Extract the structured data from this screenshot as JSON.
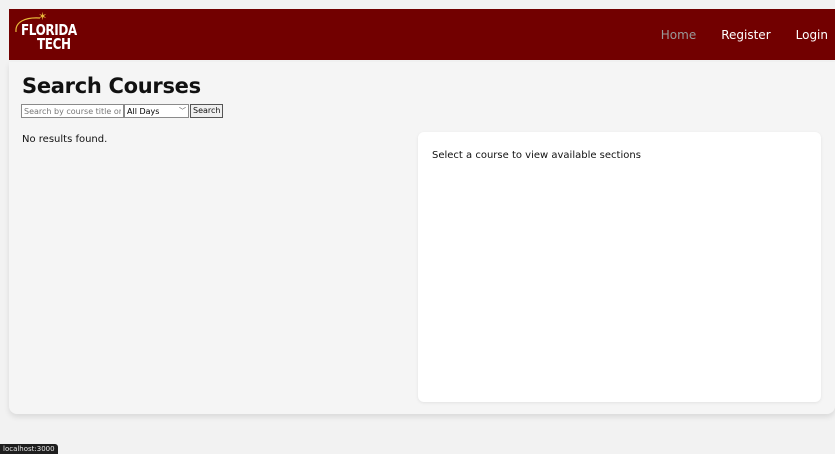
{
  "brand": {
    "logo_line1": "FLORIDA",
    "logo_line2": "TECH",
    "logo_star": "✶",
    "color": "#720000",
    "star_color": "#e8b93a"
  },
  "nav": {
    "home": "Home",
    "register": "Register",
    "login": "Login"
  },
  "page": {
    "title": "Search Courses"
  },
  "search": {
    "placeholder": "Search by course title or",
    "day_select_value": "All Days",
    "button_label": "Search"
  },
  "results": {
    "message": "No results found."
  },
  "sections_panel": {
    "message": "Select a course to view available sections"
  },
  "status_bar": {
    "url": "localhost:3000"
  }
}
